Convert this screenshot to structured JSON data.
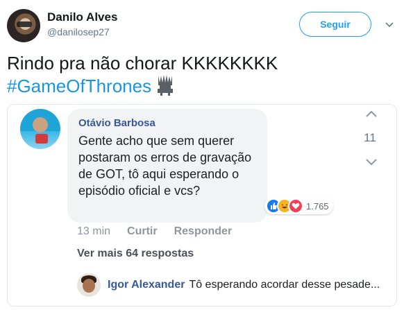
{
  "tweet": {
    "author": {
      "display_name": "Danilo Alves",
      "handle": "@danilosep27"
    },
    "follow_label": "Seguir",
    "text": "Rindo pra não chorar KKKKKKKK",
    "hashtag": "#GameOfThrones",
    "emoji_icon": "iron-throne-icon"
  },
  "embed": {
    "comment": {
      "author": "Otávio Barbosa",
      "text": "Gente acho que sem querer postaram os erros de gravação de GOT, tô aqui esperando o episódio oficial e vcs?",
      "reactions": {
        "icons": [
          "like-icon",
          "haha-icon",
          "love-icon"
        ],
        "count": "1.765"
      },
      "time": "13 min",
      "like_label": "Curtir",
      "reply_label": "Responder",
      "votes": "11"
    },
    "more_replies_label": "Ver mais 64 respostas",
    "reply": {
      "author": "Igor Alexander",
      "text": "Tô esperando acordar desse pesade..."
    }
  },
  "colors": {
    "twitter_blue": "#1da1f2",
    "hashtag_blue": "#1b95e0",
    "facebook_name": "#385898",
    "bubble_bg": "#f2f3f5"
  }
}
